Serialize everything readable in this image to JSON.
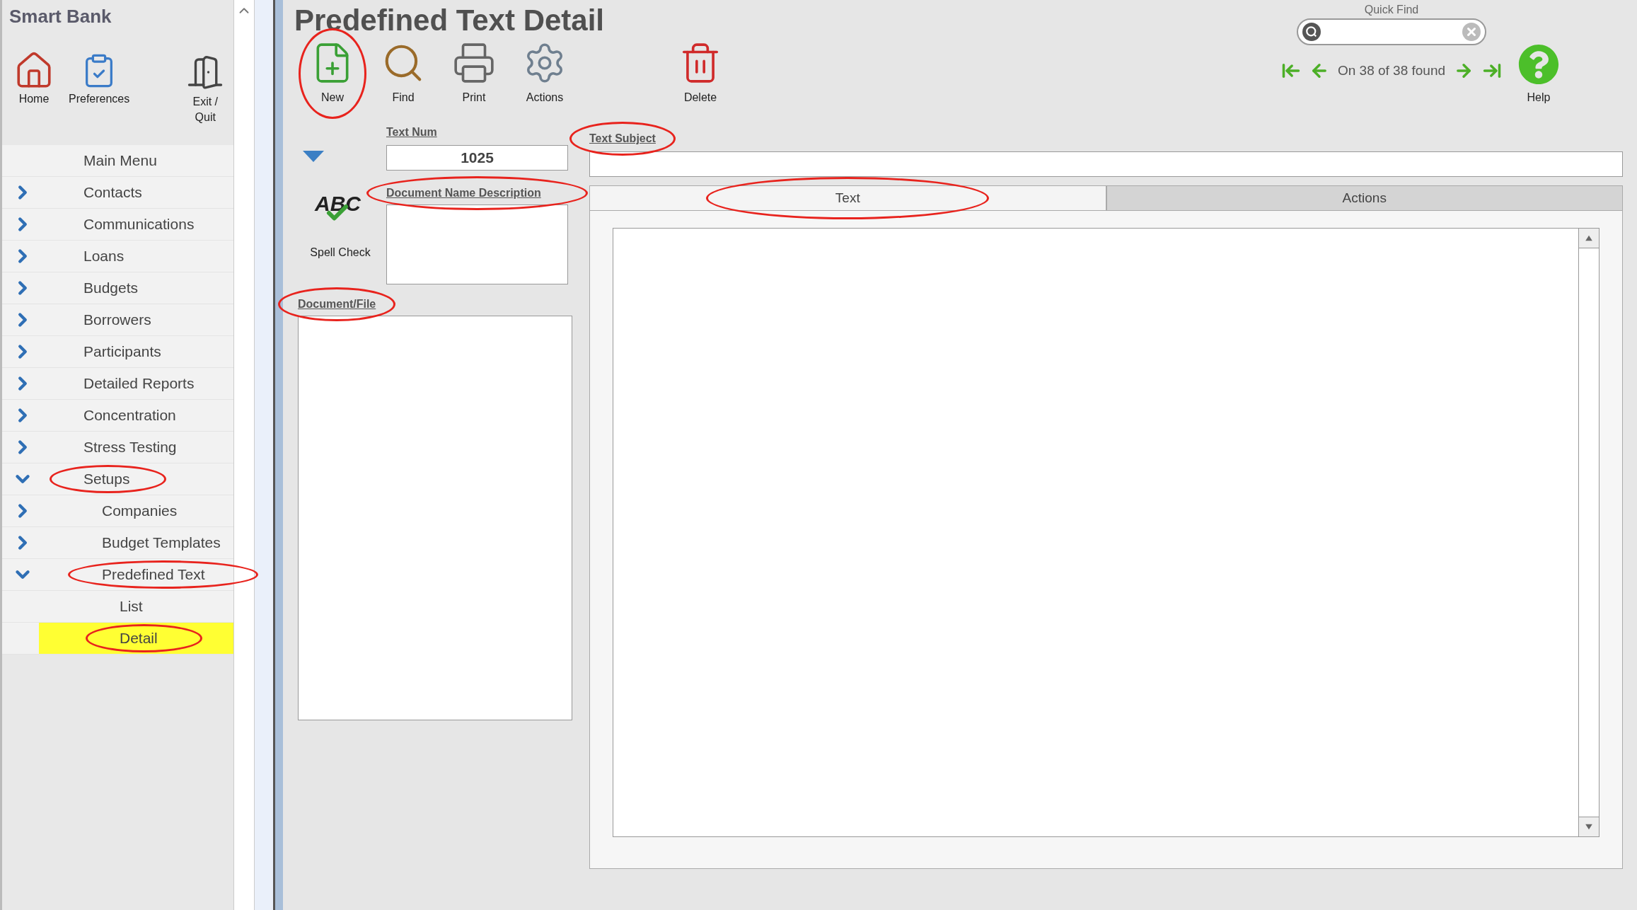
{
  "app": {
    "title": "Smart Bank"
  },
  "sidebar_tools": [
    {
      "kind": "home",
      "label": "Home"
    },
    {
      "kind": "preferences",
      "label": "Preferences"
    },
    {
      "kind": "exit",
      "label": "Exit /\nQuit"
    }
  ],
  "sidebar": {
    "header": "Main Menu",
    "items": [
      {
        "label": "Contacts",
        "expanded": false,
        "selected": false,
        "circled": false
      },
      {
        "label": "Communications",
        "expanded": false,
        "selected": false,
        "circled": false
      },
      {
        "label": "Loans",
        "expanded": false,
        "selected": false,
        "circled": false
      },
      {
        "label": "Budgets",
        "expanded": false,
        "selected": false,
        "circled": false
      },
      {
        "label": "Borrowers",
        "expanded": false,
        "selected": false,
        "circled": false
      },
      {
        "label": "Participants",
        "expanded": false,
        "selected": false,
        "circled": false
      },
      {
        "label": "Detailed Reports",
        "expanded": false,
        "selected": false,
        "circled": false
      },
      {
        "label": "Concentration",
        "expanded": false,
        "selected": false,
        "circled": false
      },
      {
        "label": "Stress Testing",
        "expanded": false,
        "selected": false,
        "circled": false
      },
      {
        "label": "Setups",
        "expanded": true,
        "selected": false,
        "circled": true,
        "children": [
          {
            "label": "Companies",
            "expanded": false,
            "selected": false,
            "circled": false
          },
          {
            "label": "Budget Templates",
            "expanded": false,
            "selected": false,
            "circled": false
          },
          {
            "label": "Predefined Text",
            "expanded": true,
            "selected": false,
            "circled": true,
            "children": [
              {
                "label": "List",
                "selected": false,
                "circled": false
              },
              {
                "label": "Detail",
                "selected": true,
                "circled": true
              }
            ]
          }
        ]
      }
    ]
  },
  "page_title": "Predefined Text Detail",
  "toolbar": [
    {
      "kind": "new",
      "label": "New",
      "circled": true
    },
    {
      "kind": "find",
      "label": "Find",
      "circled": false
    },
    {
      "kind": "print",
      "label": "Print",
      "circled": false
    },
    {
      "kind": "actions",
      "label": "Actions",
      "circled": false
    },
    {
      "kind": "delete",
      "label": "Delete",
      "circled": false
    }
  ],
  "quick_find": {
    "label": "Quick Find"
  },
  "navigation": {
    "status": "On 38 of 38 found"
  },
  "help": {
    "label": "Help"
  },
  "form": {
    "text_num": {
      "label": "Text Num",
      "value": "1025",
      "circled": false
    },
    "text_subject": {
      "label": "Text Subject",
      "circled": true
    },
    "spell_check": {
      "icon_text": "ABC",
      "label": "Spell Check"
    },
    "document_name_description": {
      "label": "Document Name Description",
      "circled": true
    },
    "document_file": {
      "label": "Document/File",
      "circled": true
    }
  },
  "tabs": [
    {
      "label": "Text",
      "selected": true,
      "circled": true
    },
    {
      "label": "Actions",
      "selected": false,
      "circled": false
    }
  ]
}
